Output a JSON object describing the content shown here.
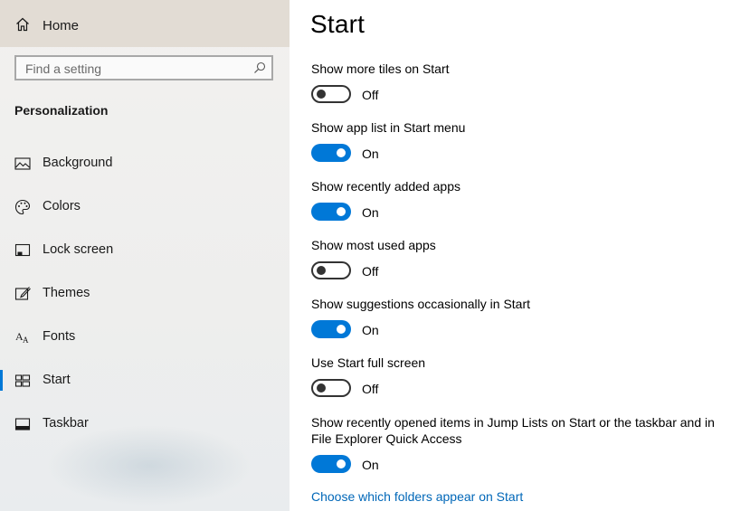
{
  "sidebar": {
    "home_label": "Home",
    "search_placeholder": "Find a setting",
    "section_title": "Personalization",
    "items": [
      {
        "label": "Background",
        "icon": "image-icon"
      },
      {
        "label": "Colors",
        "icon": "palette-icon"
      },
      {
        "label": "Lock screen",
        "icon": "lock-screen-icon"
      },
      {
        "label": "Themes",
        "icon": "themes-icon"
      },
      {
        "label": "Fonts",
        "icon": "fonts-icon"
      },
      {
        "label": "Start",
        "icon": "start-icon",
        "selected": true
      },
      {
        "label": "Taskbar",
        "icon": "taskbar-icon"
      }
    ]
  },
  "main": {
    "title": "Start",
    "settings": [
      {
        "label": "Show more tiles on Start",
        "state": "Off"
      },
      {
        "label": "Show app list in Start menu",
        "state": "On"
      },
      {
        "label": "Show recently added apps",
        "state": "On"
      },
      {
        "label": "Show most used apps",
        "state": "Off"
      },
      {
        "label": "Show suggestions occasionally in Start",
        "state": "On"
      },
      {
        "label": "Use Start full screen",
        "state": "Off"
      },
      {
        "label_line1": "Show recently opened items in Jump Lists on Start or the taskbar and in",
        "label_line2": "File Explorer Quick Access",
        "state": "On"
      }
    ],
    "link": "Choose which folders appear on Start"
  },
  "colors": {
    "accent": "#0078d7",
    "link": "#0067b8",
    "home_bg": "#e2dcd4"
  }
}
